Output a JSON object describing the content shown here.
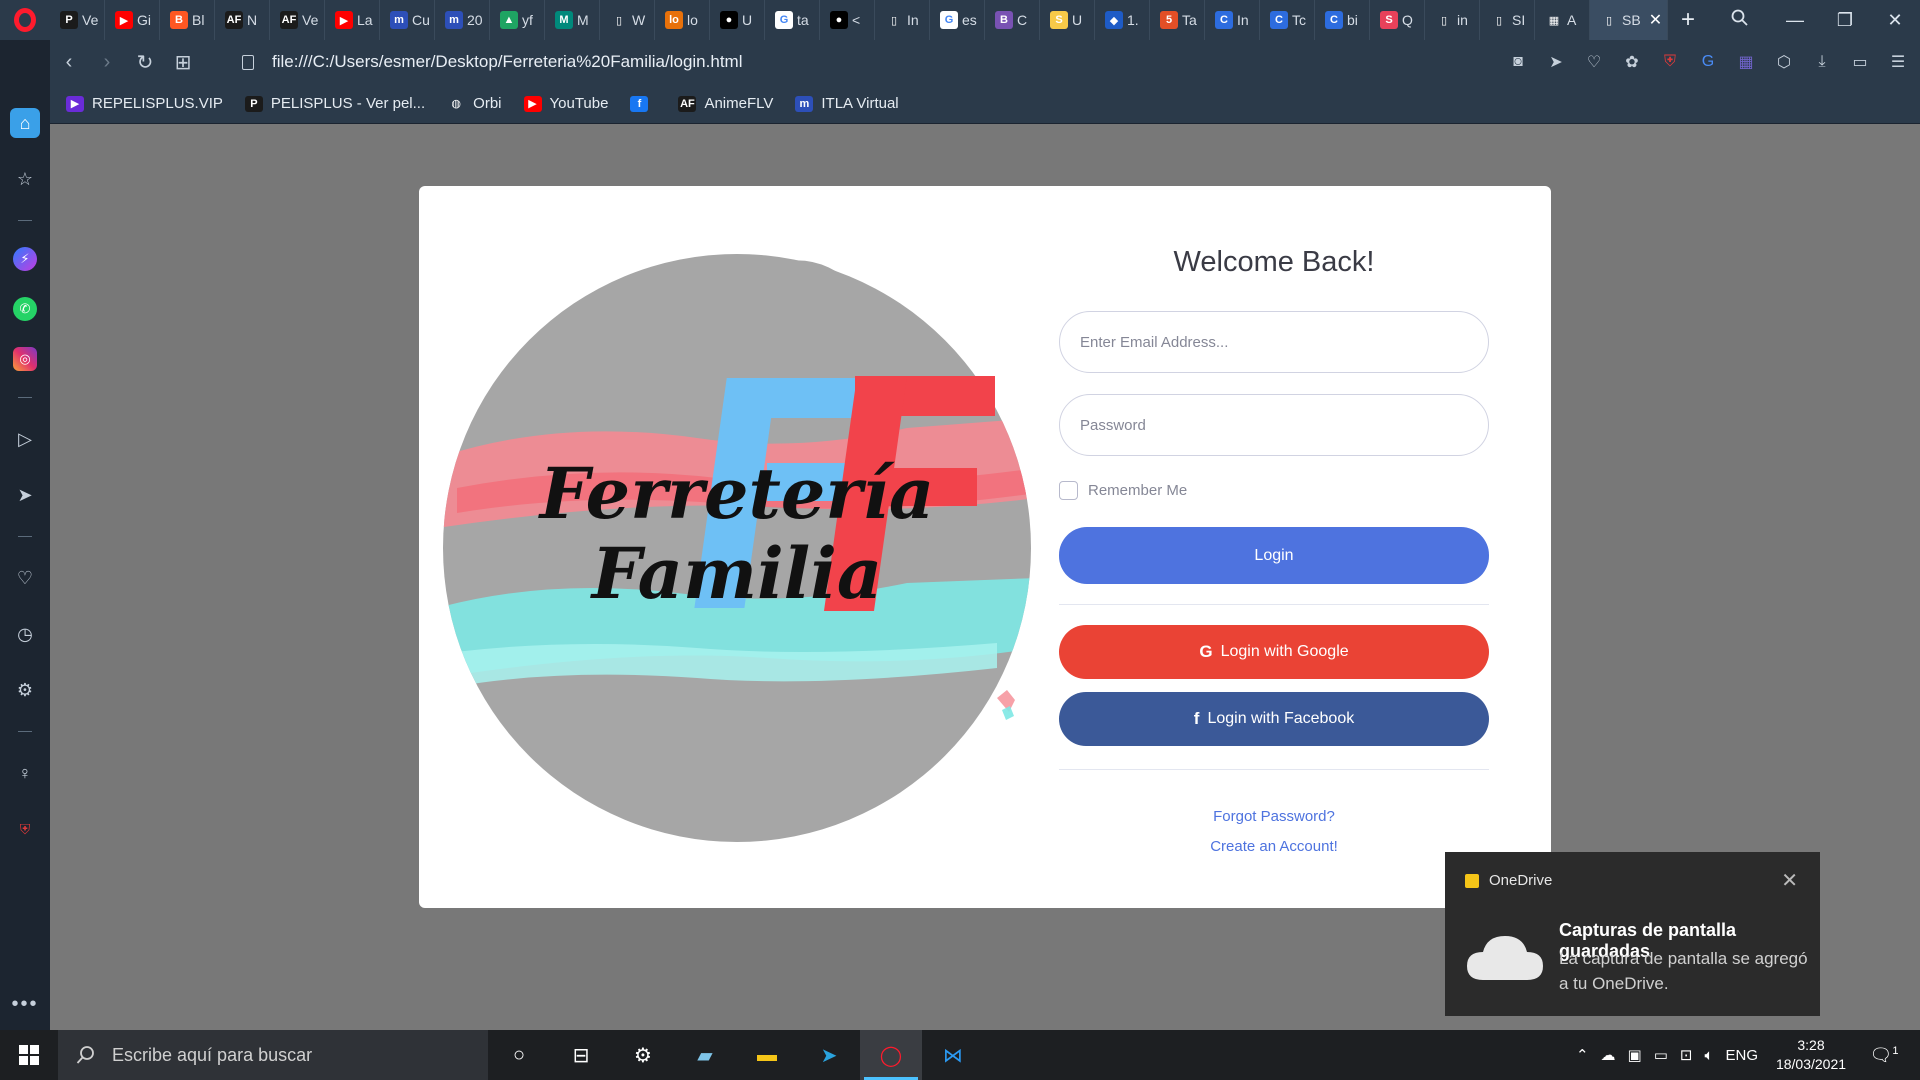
{
  "browser": {
    "tabs": [
      {
        "text": "Ve",
        "icon": "P",
        "color": "#1b1b1b"
      },
      {
        "text": "Gi",
        "icon": "▶",
        "color": "#ff0000"
      },
      {
        "text": "Bl",
        "icon": "B",
        "color": "#ff5722"
      },
      {
        "text": "N",
        "icon": "AF",
        "color": "#1b1b1b"
      },
      {
        "text": "Ve",
        "icon": "AF",
        "color": "#1b1b1b"
      },
      {
        "text": "La",
        "icon": "▶",
        "color": "#ff0000"
      },
      {
        "text": "Cu",
        "icon": "m",
        "color": "#2d4fb8"
      },
      {
        "text": "20",
        "icon": "m",
        "color": "#2d4fb8"
      },
      {
        "text": "yf",
        "icon": "▲",
        "color": "#1fa463"
      },
      {
        "text": "M",
        "icon": "M",
        "color": "#00897b"
      },
      {
        "text": "W",
        "icon": "▯",
        "color": "#2b3a4a"
      },
      {
        "text": "lo",
        "icon": "lo",
        "color": "#e8710a"
      },
      {
        "text": "U",
        "icon": "●",
        "color": "#000000"
      },
      {
        "text": "ta",
        "icon": "G",
        "color": "#ffffff"
      },
      {
        "text": "<",
        "icon": "●",
        "color": "#000000"
      },
      {
        "text": "In",
        "icon": "▯",
        "color": "#2b3a4a"
      },
      {
        "text": "es",
        "icon": "G",
        "color": "#ffffff"
      },
      {
        "text": "C",
        "icon": "B",
        "color": "#7952b3"
      },
      {
        "text": "U",
        "icon": "S",
        "color": "#f7c948"
      },
      {
        "text": "1.",
        "icon": "◆",
        "color": "#1e5bc6"
      },
      {
        "text": "Ta",
        "icon": "5",
        "color": "#e34f26"
      },
      {
        "text": "In",
        "icon": "C",
        "color": "#2d6cdf"
      },
      {
        "text": "Tc",
        "icon": "C",
        "color": "#2d6cdf"
      },
      {
        "text": "bi",
        "icon": "C",
        "color": "#2d6cdf"
      },
      {
        "text": "Q",
        "icon": "S",
        "color": "#e8415a"
      },
      {
        "text": "in",
        "icon": "▯",
        "color": "#2b3a4a"
      },
      {
        "text": "SI",
        "icon": "▯",
        "color": "#2b3a4a"
      },
      {
        "text": "A",
        "icon": "▦",
        "color": "#2b3a4a"
      }
    ],
    "active_tab": {
      "text": "SB",
      "icon": "▯"
    },
    "url": "file:///C:/Users/esmer/Desktop/Ferreteria%20Familia/login.html",
    "bookmarks": [
      {
        "label": "REPELISPLUS.VIP",
        "icon": "▶",
        "color": "#6a2cd8"
      },
      {
        "label": "PELISPLUS - Ver pel...",
        "icon": "P",
        "color": "#1b1b1b"
      },
      {
        "label": "Orbi",
        "icon": "◍",
        "color": "#2b3a4a"
      },
      {
        "label": "YouTube",
        "icon": "▶",
        "color": "#ff0000"
      },
      {
        "label": "",
        "icon": "f",
        "color": "#1877f2"
      },
      {
        "label": "AnimeFLV",
        "icon": "AF",
        "color": "#1b1b1b"
      },
      {
        "label": "ITLA Virtual",
        "icon": "m",
        "color": "#2d4fb8"
      }
    ]
  },
  "logo": {
    "line1": "Ferretería",
    "line2": "Familia",
    "monogram": "FF",
    "colors": {
      "circle": "#a6a6a6",
      "red": "#f2434b",
      "blue": "#6ec0f5",
      "pink": "#f58a92",
      "cyan": "#7ee8e4"
    }
  },
  "login": {
    "title": "Welcome Back!",
    "email_placeholder": "Enter Email Address...",
    "password_placeholder": "Password",
    "remember_label": "Remember Me",
    "login_button": "Login",
    "google_button": "Login with Google",
    "facebook_button": "Login with Facebook",
    "forgot_link": "Forgot Password?",
    "create_link": "Create an Account!",
    "colors": {
      "primary": "#4e73df",
      "google": "#ea4335",
      "facebook": "#3b5998"
    }
  },
  "toast": {
    "app": "OneDrive",
    "title": "Capturas de pantalla guardadas",
    "body": "La captura de pantalla se agregó a tu OneDrive."
  },
  "taskbar": {
    "search_placeholder": "Escribe aquí para buscar",
    "language": "ENG",
    "time": "3:28",
    "date": "18/03/2021",
    "notifications": "1"
  }
}
